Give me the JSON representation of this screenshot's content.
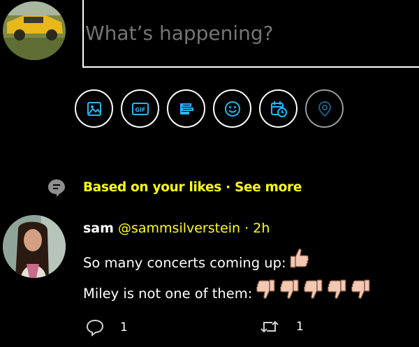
{
  "compose": {
    "placeholder": "What’s happening?",
    "toolbar": [
      {
        "name": "image-icon",
        "enabled": true
      },
      {
        "name": "gif-icon",
        "label": "GIF",
        "enabled": true
      },
      {
        "name": "poll-icon",
        "enabled": true
      },
      {
        "name": "emoji-icon",
        "enabled": true
      },
      {
        "name": "schedule-icon",
        "enabled": true
      },
      {
        "name": "location-icon",
        "enabled": false
      }
    ]
  },
  "recommendation": {
    "text": "Based on your likes",
    "separator": " · ",
    "link": "See more"
  },
  "tweet": {
    "name": "sam",
    "handle": "@sammsilverstein",
    "separator": " · ",
    "time": "2h",
    "line1": "So many concerts coming up:",
    "line2": "Miley is not one of them:",
    "line1_emoji": [
      "thumbs-up"
    ],
    "line2_emoji": [
      "thumbs-down",
      "thumbs-down",
      "thumbs-down",
      "thumbs-down",
      "thumbs-down"
    ],
    "reply_count": "1",
    "retweet_count": "1"
  },
  "colors": {
    "accent": "#ffff1a",
    "background": "#000000",
    "text": "#ffffff",
    "icon": "#29b6f6",
    "emoji_skin": "#f4c7b0"
  }
}
